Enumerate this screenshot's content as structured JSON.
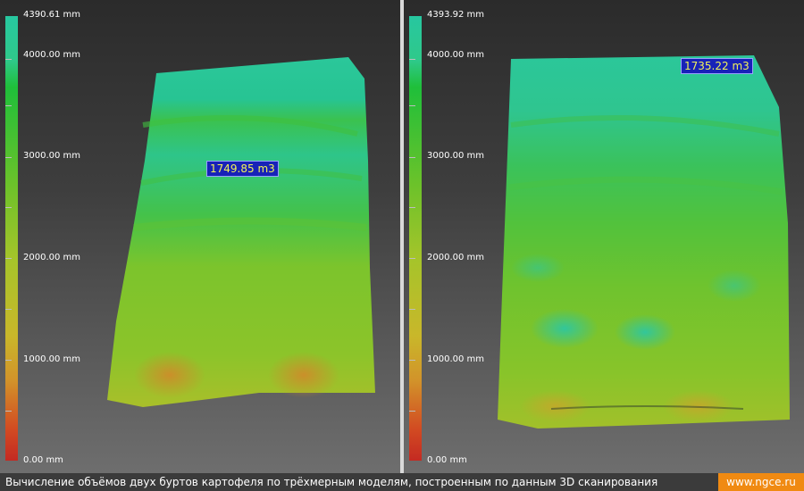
{
  "left_view": {
    "scale": {
      "max_label": "4390.61 mm",
      "labels": [
        "4000.00 mm",
        "3000.00 mm",
        "2000.00 mm",
        "1000.00 mm",
        "0.00 mm"
      ]
    },
    "volume_label": "1749.85 m3"
  },
  "right_view": {
    "scale": {
      "max_label": "4393.92 mm",
      "labels": [
        "4000.00 mm",
        "3000.00 mm",
        "2000.00 mm",
        "1000.00 mm",
        "0.00 mm"
      ]
    },
    "volume_label": "1735.22 m3"
  },
  "footer": {
    "caption": "Вычисление объёмов двух буртов картофеля по трёхмерным моделям, построенным по данным 3D сканирования",
    "site": "www.ngce.ru",
    "site_color": "#f08a12"
  },
  "colors": {
    "high": "#27c7a0",
    "mid": "#6cc22a",
    "low": "#c42a22",
    "label_bg": "#1822b8",
    "label_text": "#f2f25a"
  }
}
